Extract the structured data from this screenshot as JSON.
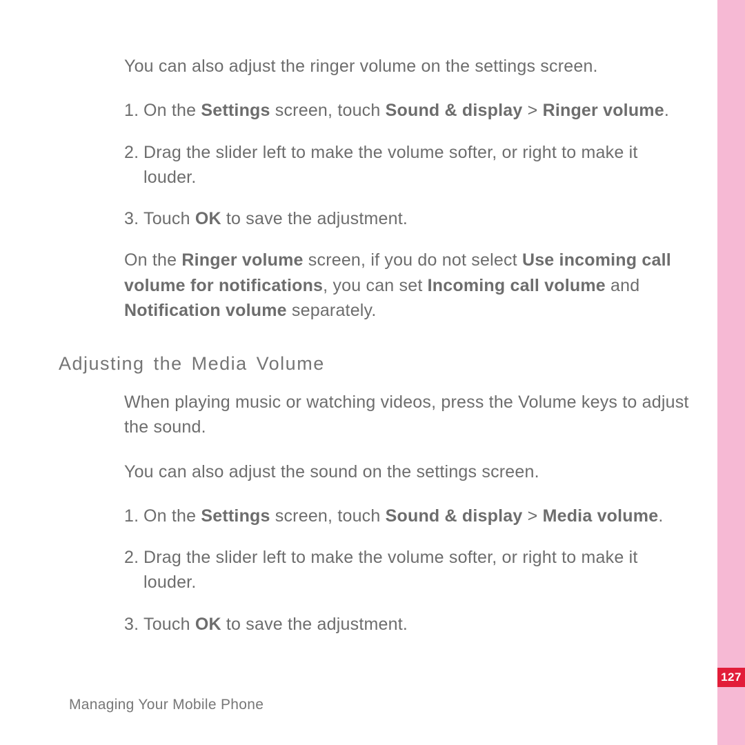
{
  "intro1": "You can also adjust the ringer volume on the settings screen.",
  "stepsA": {
    "n1": "1.",
    "s1a": "On the ",
    "s1b": "Settings",
    "s1c": " screen, touch ",
    "s1d": "Sound & display",
    "s1e": " > ",
    "s1f": "Ringer volume",
    "s1g": ".",
    "n2": "2.",
    "s2": "Drag the slider left to make the volume softer, or right to make it louder.",
    "n3": "3.",
    "s3a": "Touch ",
    "s3b": "OK",
    "s3c": " to save the adjustment."
  },
  "note": {
    "a": "On the ",
    "b": "Ringer volume",
    "c": " screen, if you do not select ",
    "d": "Use incoming call volume for notifications",
    "e": ", you can set ",
    "f": "Incoming call volume",
    "g": " and ",
    "h": "Notification volume",
    "i": " separately."
  },
  "heading": "Adjusting the Media Volume",
  "intro2": "When playing music or watching videos, press the Volume keys to adjust the sound.",
  "intro3": "You can also adjust the sound on the settings screen.",
  "stepsB": {
    "n1": "1.",
    "s1a": "On the ",
    "s1b": "Settings",
    "s1c": " screen, touch ",
    "s1d": "Sound & display",
    "s1e": " > ",
    "s1f": "Media volume",
    "s1g": ".",
    "n2": "2.",
    "s2": "Drag the slider left to make the volume softer, or right to make it louder.",
    "n3": "3.",
    "s3a": "Touch ",
    "s3b": "OK",
    "s3c": " to save the adjustment."
  },
  "footer": "Managing Your Mobile Phone",
  "pageNumber": "127"
}
